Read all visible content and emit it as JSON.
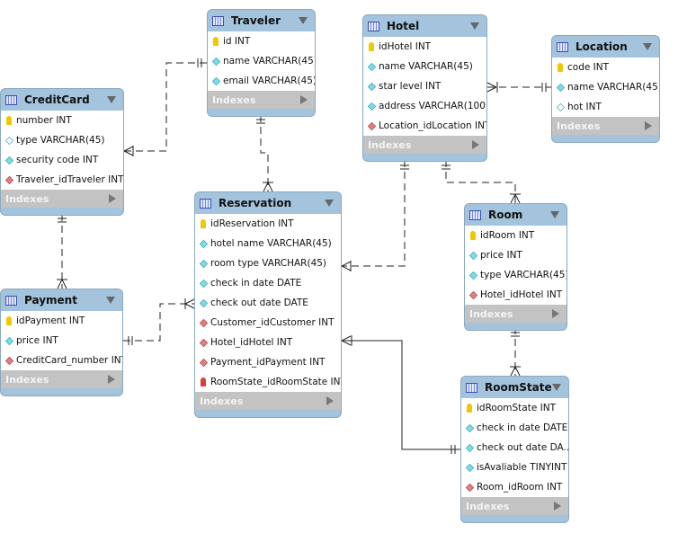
{
  "indexes_label": "Indexes",
  "tables": [
    {
      "id": "traveler",
      "name": "Traveler",
      "columns": [
        {
          "text": "id INT",
          "icon": "pk"
        },
        {
          "text": "name VARCHAR(45)",
          "icon": "fill"
        },
        {
          "text": "email VARCHAR(45)",
          "icon": "fill"
        }
      ]
    },
    {
      "id": "creditcard",
      "name": "CreditCard",
      "columns": [
        {
          "text": "number INT",
          "icon": "pk"
        },
        {
          "text": "type VARCHAR(45)",
          "icon": "hollow"
        },
        {
          "text": "security code INT",
          "icon": "fill"
        },
        {
          "text": "Traveler_idTraveler INT",
          "icon": "fk"
        }
      ]
    },
    {
      "id": "hotel",
      "name": "Hotel",
      "columns": [
        {
          "text": "idHotel INT",
          "icon": "pk"
        },
        {
          "text": "name VARCHAR(45)",
          "icon": "fill"
        },
        {
          "text": "star level INT",
          "icon": "fill"
        },
        {
          "text": "address VARCHAR(100)",
          "icon": "fill"
        },
        {
          "text": "Location_idLocation INT",
          "icon": "fk"
        }
      ]
    },
    {
      "id": "location",
      "name": "Location",
      "columns": [
        {
          "text": "code INT",
          "icon": "pk"
        },
        {
          "text": "name VARCHAR(45)",
          "icon": "fill"
        },
        {
          "text": "hot INT",
          "icon": "hollow"
        }
      ]
    },
    {
      "id": "reservation",
      "name": "Reservation",
      "columns": [
        {
          "text": "idReservation INT",
          "icon": "pk"
        },
        {
          "text": "hotel name VARCHAR(45)",
          "icon": "fill"
        },
        {
          "text": "room type VARCHAR(45)",
          "icon": "fill"
        },
        {
          "text": "check in date DATE",
          "icon": "fill"
        },
        {
          "text": "check out date DATE",
          "icon": "fill"
        },
        {
          "text": "Customer_idCustomer INT",
          "icon": "fk"
        },
        {
          "text": "Hotel_idHotel INT",
          "icon": "fk"
        },
        {
          "text": "Payment_idPayment INT",
          "icon": "fk"
        },
        {
          "text": "RoomState_idRoomState INT",
          "icon": "pkfk"
        }
      ]
    },
    {
      "id": "payment",
      "name": "Payment",
      "columns": [
        {
          "text": "idPayment INT",
          "icon": "pk"
        },
        {
          "text": "price INT",
          "icon": "fill"
        },
        {
          "text": "CreditCard_number INT",
          "icon": "fk"
        }
      ]
    },
    {
      "id": "room",
      "name": "Room",
      "columns": [
        {
          "text": "idRoom INT",
          "icon": "pk"
        },
        {
          "text": "price INT",
          "icon": "fill"
        },
        {
          "text": "type VARCHAR(45)",
          "icon": "fill"
        },
        {
          "text": "Hotel_idHotel INT",
          "icon": "fk"
        }
      ]
    },
    {
      "id": "roomstate",
      "name": "RoomState",
      "columns": [
        {
          "text": "idRoomState INT",
          "icon": "pk"
        },
        {
          "text": "check in date DATE",
          "icon": "fill"
        },
        {
          "text": "check out date DA...",
          "icon": "fill"
        },
        {
          "text": "isAvaliable TINYINT",
          "icon": "fill"
        },
        {
          "text": "Room_idRoom INT",
          "icon": "fk"
        }
      ]
    }
  ],
  "relationships": [
    {
      "from": "Traveler",
      "to": "CreditCard",
      "style": "dashed"
    },
    {
      "from": "Traveler",
      "to": "Reservation",
      "style": "dashed"
    },
    {
      "from": "CreditCard",
      "to": "Payment",
      "style": "dashed"
    },
    {
      "from": "Payment",
      "to": "Reservation",
      "style": "dashed"
    },
    {
      "from": "Hotel",
      "to": "Reservation",
      "style": "dashed"
    },
    {
      "from": "Location",
      "to": "Hotel",
      "style": "dashed"
    },
    {
      "from": "Hotel",
      "to": "Room",
      "style": "dashed"
    },
    {
      "from": "Room",
      "to": "RoomState",
      "style": "dashed"
    },
    {
      "from": "RoomState",
      "to": "Reservation",
      "style": "solid"
    }
  ],
  "colors": {
    "header": "#a3c4dc",
    "indexes": "#c3c3c3",
    "line": "#222222"
  }
}
